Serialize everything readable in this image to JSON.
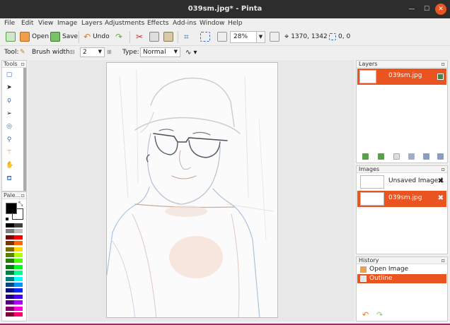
{
  "window": {
    "title": "039sm.jpg* - Pinta"
  },
  "menu": [
    "File",
    "Edit",
    "View",
    "Image",
    "Layers",
    "Adjustments",
    "Effects",
    "Add-ins",
    "Window",
    "Help"
  ],
  "toolbar": {
    "open_label": "Open",
    "save_label": "Save",
    "undo_label": "Undo",
    "zoom_value": "28%",
    "cursor_position": "1370, 1342",
    "selection_size": "0, 0"
  },
  "tool_options": {
    "tool_label": "Tool:",
    "brush_width_label": "Brush width:",
    "brush_width_value": "2",
    "type_label": "Type:",
    "type_value": "Normal"
  },
  "panels": {
    "tools_title": "Tools",
    "palette_title": "Pale...",
    "layers_title": "Layers",
    "images_title": "Images",
    "history_title": "History"
  },
  "layers": [
    {
      "name": "039sm.jpg",
      "selected": true
    }
  ],
  "images": [
    {
      "name": "Unsaved Image 1",
      "selected": false
    },
    {
      "name": "039sm.jpg",
      "selected": true
    }
  ],
  "history": [
    {
      "name": "Open Image",
      "selected": false
    },
    {
      "name": "Outline",
      "selected": true
    }
  ],
  "colors": {
    "accent": "#e95420",
    "primary_color": "#000000",
    "secondary_color": "#ffffff"
  }
}
